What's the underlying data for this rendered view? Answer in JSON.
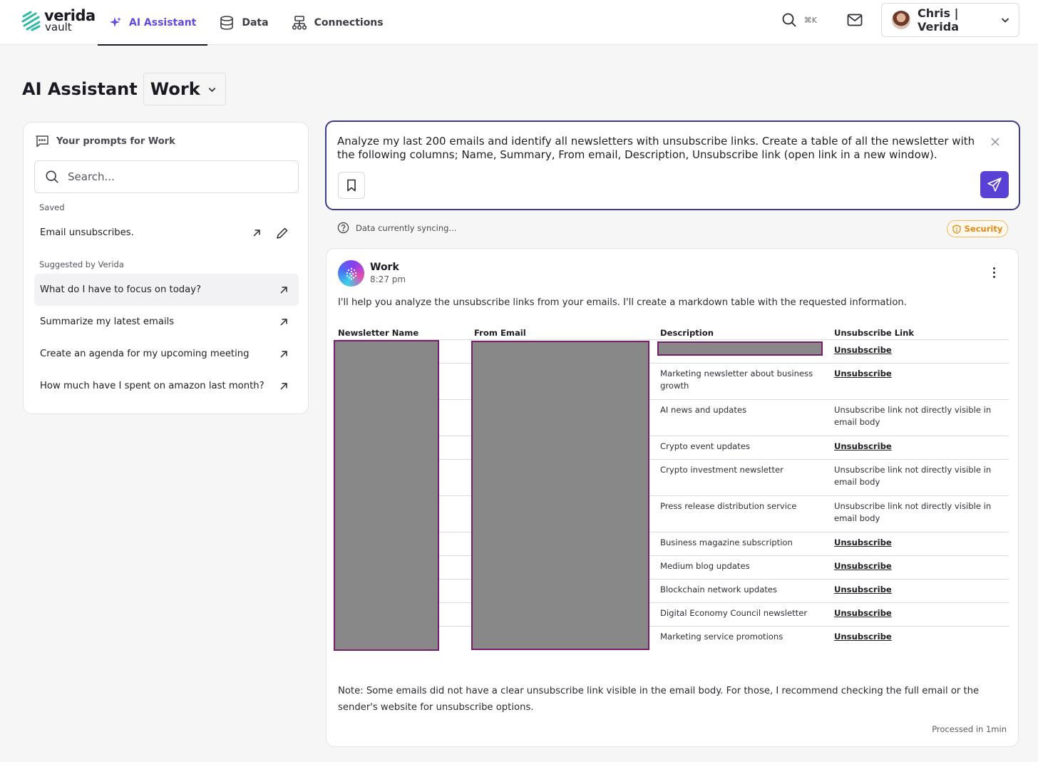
{
  "brand": {
    "line1": "verida",
    "line2": "vault"
  },
  "nav": [
    {
      "label": "AI Assistant",
      "icon": "sparkle-icon",
      "active": true
    },
    {
      "label": "Data",
      "icon": "database-icon",
      "active": false
    },
    {
      "label": "Connections",
      "icon": "connections-icon",
      "active": false
    }
  ],
  "header": {
    "shortcut": "⌘K",
    "user_name": "Chris | Verida"
  },
  "page": {
    "title": "AI Assistant",
    "workspace": "Work"
  },
  "prompts": {
    "heading": "Your prompts for Work",
    "search_placeholder": "Search...",
    "saved_label": "Saved",
    "saved": [
      {
        "label": "Email unsubscribes."
      }
    ],
    "suggested_label": "Suggested by Verida",
    "suggested": [
      {
        "label": "What do I have to focus on today?"
      },
      {
        "label": "Summarize my latest emails"
      },
      {
        "label": "Create an agenda for my upcoming meeting"
      },
      {
        "label": "How much have I spent on amazon last month?"
      }
    ]
  },
  "query": {
    "text": "Analyze my last 200 emails and identify all newsletters with unsubscribe links. Create a table of all the newsletter with the following columns; Name, Summary, From email, Description, Unsubscribe link (open link in a new window)."
  },
  "status": {
    "sync_text": "Data currently syncing...",
    "security_label": "Security"
  },
  "response": {
    "author": "Work",
    "time": "8:27 pm",
    "intro": "I'll help you analyze the unsubscribe links from your emails. I'll create a markdown table with the requested information.",
    "table": {
      "headers": [
        "Newsletter Name",
        "From Email",
        "Description",
        "Unsubscribe Link"
      ],
      "rows": [
        {
          "description": "",
          "unsubscribe": "Unsubscribe",
          "is_link": true
        },
        {
          "description": "Marketing newsletter about business growth",
          "unsubscribe": "Unsubscribe",
          "is_link": true
        },
        {
          "description": "AI news and updates",
          "unsubscribe": "Unsubscribe link not directly visible in email body",
          "is_link": false
        },
        {
          "description": "Crypto event updates",
          "unsubscribe": "Unsubscribe",
          "is_link": true
        },
        {
          "description": "Crypto investment newsletter",
          "unsubscribe": "Unsubscribe link not directly visible in email body",
          "is_link": false
        },
        {
          "description": "Press release distribution service",
          "unsubscribe": "Unsubscribe link not directly visible in email body",
          "is_link": false
        },
        {
          "description": "Business magazine subscription",
          "unsubscribe": "Unsubscribe",
          "is_link": true
        },
        {
          "description": "Medium blog updates",
          "unsubscribe": "Unsubscribe",
          "is_link": true
        },
        {
          "description": "Blockchain network updates",
          "unsubscribe": "Unsubscribe",
          "is_link": true
        },
        {
          "description": "Digital Economy Council newsletter",
          "unsubscribe": "Unsubscribe",
          "is_link": true
        },
        {
          "description": "Marketing service promotions",
          "unsubscribe": "Unsubscribe",
          "is_link": true
        }
      ]
    },
    "note": "Note: Some emails did not have a clear unsubscribe link visible in the email body. For those, I recommend checking the full email or the sender's website for unsubscribe options.",
    "processed": "Processed in 1min"
  },
  "colors": {
    "accent": "#5a41d6",
    "nav_active": "#6548e0",
    "security": "#e38a14",
    "redaction": "#888888",
    "redaction_border": "#7a1b6c"
  }
}
